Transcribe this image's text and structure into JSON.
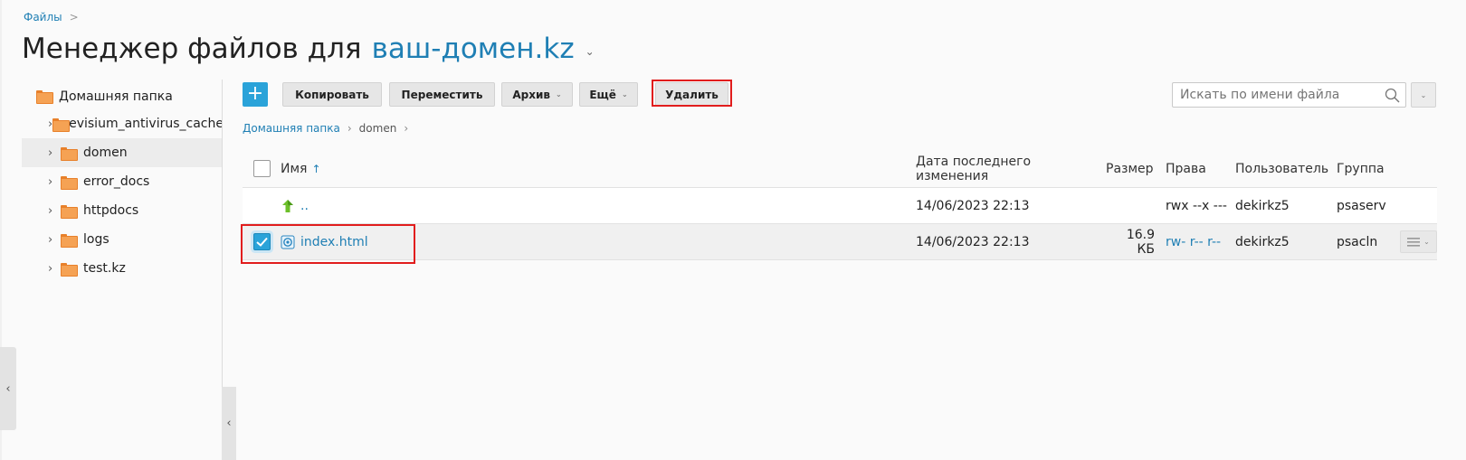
{
  "breadcrumb": {
    "root_label": "Файлы",
    "separator": ">"
  },
  "title": {
    "prefix": "Менеджер файлов для",
    "domain": "ваш-домен.kz"
  },
  "tree": {
    "root_label": "Домашняя папка",
    "items": [
      {
        "label": ".revisium_antivirus_cache"
      },
      {
        "label": "domen"
      },
      {
        "label": "error_docs"
      },
      {
        "label": "httpdocs"
      },
      {
        "label": "logs"
      },
      {
        "label": "test.kz"
      }
    ]
  },
  "toolbar": {
    "add_label": "+",
    "copy_label": "Копировать",
    "move_label": "Переместить",
    "archive_label": "Архив",
    "more_label": "Ещё",
    "delete_label": "Удалить",
    "search_placeholder": "Искать по имени файла"
  },
  "path": {
    "root": "Домашняя папка",
    "current": "domen"
  },
  "table": {
    "headers": {
      "name": "Имя",
      "sort_indicator": "↑",
      "date": "Дата последнего изменения",
      "size": "Размер",
      "perms": "Права",
      "user": "Пользователь",
      "group": "Группа"
    },
    "rows": [
      {
        "name": "..",
        "date": "14/06/2023 22:13",
        "size": "",
        "perms": "rwx --x ---",
        "user": "dekirkz5",
        "group": "psaserv",
        "checked": false
      },
      {
        "name": "index.html",
        "date": "14/06/2023 22:13",
        "size": "16.9 КБ",
        "perms": "rw- r-- r--",
        "user": "dekirkz5",
        "group": "psacln",
        "checked": true
      }
    ]
  },
  "colors": {
    "accent": "#1f7fb4",
    "primary_button": "#2aa3d9",
    "highlight_border": "#e11d1d",
    "folder": "#f5a254"
  }
}
